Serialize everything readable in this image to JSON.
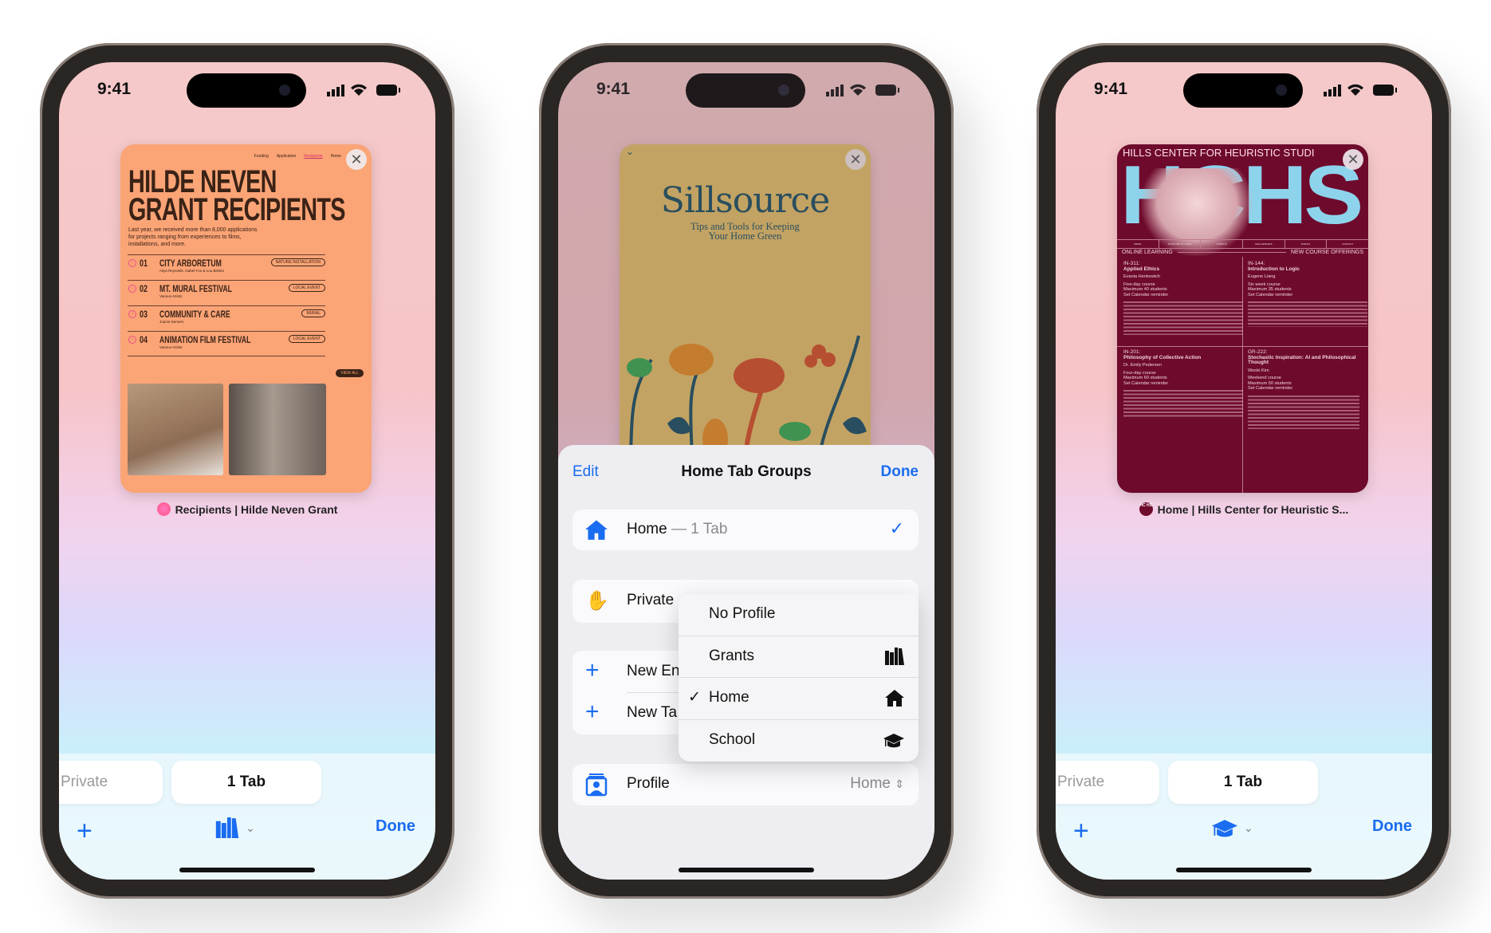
{
  "status": {
    "time": "9:41"
  },
  "colors": {
    "accent": "#1a6cf0",
    "grants_card": "#fba476",
    "home_card": "#e3c063",
    "school_card": "#6e0a2c"
  },
  "phone_left": {
    "card": {
      "nav": [
        "Funding",
        "Application",
        "Recipients",
        "Home"
      ],
      "heading": [
        "HILDE NEVEN",
        "GRANT RECIPIENTS"
      ],
      "intro": "Last year, we received more than 8,000 applications for projects ranging from experiences to films, installations, and more.",
      "rows": [
        {
          "num": "01",
          "title": "CITY ARBORETUM",
          "sub": "Aliya Reynolds, Isabel Foo & Lou Belsito",
          "tag": "NATURE INSTALLATION"
        },
        {
          "num": "02",
          "title": "MT. MURAL FESTIVAL",
          "sub": "Various Artists",
          "tag": "LOCAL EVENT"
        },
        {
          "num": "03",
          "title": "COMMUNITY & CARE",
          "sub": "Joanie Demers",
          "tag": "MURAL"
        },
        {
          "num": "04",
          "title": "ANIMATION FILM FESTIVAL",
          "sub": "Various Artists",
          "tag": "LOCAL EVENT"
        }
      ],
      "view_all": "VIEW ALL"
    },
    "tab_title": "Recipients | Hilde Neven Grant",
    "segments": {
      "private": "Private",
      "tabs": "1 Tab"
    },
    "toolbar": {
      "plus": "+",
      "group_icon": "bookshelf-icon",
      "done": "Done"
    }
  },
  "phone_middle": {
    "card": {
      "logo": "Sillsource",
      "tagline_1": "Tips and Tools for Keeping",
      "tagline_2": "Your Home Green"
    },
    "sheet": {
      "edit": "Edit",
      "title": "Home Tab Groups",
      "done": "Done",
      "home_row": {
        "label": "Home",
        "detail": "— 1 Tab"
      },
      "private_row": "Private",
      "new_empty": "New En",
      "new_tab": "New Ta",
      "profile_row": {
        "label": "Profile",
        "value": "Home"
      },
      "menu": [
        {
          "label": "No Profile",
          "icon": "",
          "checked": false
        },
        {
          "label": "Grants",
          "icon": "bookshelf-icon",
          "checked": false
        },
        {
          "label": "Home",
          "icon": "house-icon",
          "checked": true
        },
        {
          "label": "School",
          "icon": "graduation-cap-icon",
          "checked": false
        }
      ],
      "check": "✓"
    }
  },
  "phone_right": {
    "card": {
      "header": "HILLS CENTER FOR HEURISTIC STUDI",
      "big": "HCHS",
      "nav": [
        "NEWS",
        "STUDYING AT HCHS",
        "CAMPUS",
        "FELLOWSHIPS",
        "PORTAL",
        "CONTACT"
      ],
      "left_label": "ONLINE LEARNING",
      "right_label": "NEW COURSE OFFERINGS",
      "courses": [
        {
          "code": "IN-311:",
          "name": "Applied Ethics",
          "teacher": "Evania Henkewich",
          "m1": "Five-day course",
          "m2": "Maximum 40 students",
          "m3": "Set Calendar reminder"
        },
        {
          "code": "IN-144:",
          "name": "Introduction to Logic",
          "teacher": "Eugene Liang",
          "m1": "Six week course",
          "m2": "Maximum 35 students",
          "m3": "Set Calendar reminder"
        },
        {
          "code": "IN-201:",
          "name": "Philosophy of Collective Action",
          "teacher": "Dr. Emily Pedersen",
          "m1": "Four-day course",
          "m2": "Maximum 60 students",
          "m3": "Set Calendar reminder"
        },
        {
          "code": "GR-222:",
          "name": "Stochastic Inspiration: AI and Philosophical Thought",
          "teacher": "Wonki Kim",
          "m1": "Weekend course",
          "m2": "Maximum 50 students",
          "m3": "Set Calendar reminder"
        }
      ]
    },
    "tab_title": "Home | Hills Center for Heuristic S...",
    "favicon": "HC HS",
    "segments": {
      "private": "Private",
      "tabs": "1 Tab"
    },
    "toolbar": {
      "plus": "+",
      "group_icon": "graduation-cap-icon",
      "done": "Done"
    }
  }
}
